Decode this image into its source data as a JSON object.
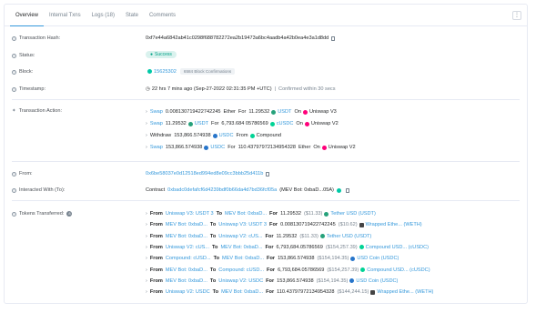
{
  "tabs": [
    "Overview",
    "Internal Txns",
    "Logs (18)",
    "State",
    "Comments"
  ],
  "labels": {
    "tx_hash": "Transaction Hash:",
    "status": "Status:",
    "block": "Block:",
    "timestamp": "Timestamp:",
    "action": "Transaction Action:",
    "from": "From:",
    "interacted": "Interacted With (To):",
    "tokens": "Tokens Transferred:"
  },
  "tx_hash": "0xf7e44a6842ab41c0298f688782272ea2b19473a6bc4aadb4a42b0ea4e3a1d8dd",
  "status": "Success",
  "block": {
    "number": "15625302",
    "confirmations": "6584 Block Confirmations"
  },
  "timestamp": {
    "text": "22 hrs 7 mins ago (Sep-27-2022 02:31:35 PM +UTC)",
    "sep": "|",
    "confirmed": "Confirmed within 30 secs"
  },
  "actions": [
    {
      "verb": "Swap",
      "amt1": "0.008130719422742245",
      "tok1": "Ether",
      "mid": "For",
      "amt2": "11.29532",
      "tok2": "USDT",
      "on": "On",
      "dex": "Uniswap V3",
      "i1": "",
      "i2": "tether",
      "i3": "uni"
    },
    {
      "verb": "Swap",
      "amt1": "11.29532",
      "tok1": "USDT",
      "mid": "For",
      "amt2": "6,793.684 05786569",
      "tok2": "cUSDC",
      "on": "On",
      "dex": "Uniswap V2",
      "i1": "tether",
      "i2": "comp",
      "i3": "uni"
    },
    {
      "verb": "Withdraw",
      "amt1": "153,866.574938",
      "tok1": "USDC",
      "mid": "From",
      "amt2": "",
      "tok2": "Compound",
      "on": "",
      "dex": "",
      "i1": "usdc",
      "i2": "comp",
      "i3": ""
    },
    {
      "verb": "Swap",
      "amt1": "153,866.574938",
      "tok1": "USDC",
      "mid": "For",
      "amt2": "110.43797972134954328",
      "tok2": "Ether",
      "on": "On",
      "dex": "Uniswap V2",
      "i1": "usdc",
      "i2": "",
      "i3": "uni"
    }
  ],
  "from": "0x6be58037e0d12518ed994ed8e09cc3bbb25d411b",
  "interacted": {
    "prefix": "Contract",
    "address": "0xbadc0defafcf6d4239bdf0b66da4d7bd36fcf05a",
    "name": "(MEV Bot: 0xbaD...05A)"
  },
  "token_count": "8",
  "transfers": [
    {
      "from_lbl": "From",
      "from": "Uniswap V3: USDT 3",
      "to_lbl": "To",
      "to": "MEV Bot: 0xbaD...",
      "for_lbl": "For",
      "amount": "11.29532",
      "usd": "($11.33)",
      "token": "Tether USD (USDT)",
      "icon": "tether"
    },
    {
      "from_lbl": "From",
      "from": "MEV Bot: 0xbaD...",
      "to_lbl": "To",
      "to": "Uniswap V3: USDT 3",
      "for_lbl": "For",
      "amount": "0.008130719422742245",
      "usd": "($10.62)",
      "token": "Wrapped Ethe... (WETH)",
      "icon": "weth"
    },
    {
      "from_lbl": "From",
      "from": "MEV Bot: 0xbaD...",
      "to_lbl": "To",
      "to": "Uniswap V2: cUS...",
      "for_lbl": "For",
      "amount": "11.29532",
      "usd": "($11.33)",
      "token": "Tether USD (USDT)",
      "icon": "tether"
    },
    {
      "from_lbl": "From",
      "from": "Uniswap V2: cUS...",
      "to_lbl": "To",
      "to": "MEV Bot: 0xbaD...",
      "for_lbl": "For",
      "amount": "6,793,684.05786569",
      "usd": "($154,257.39)",
      "token": "Compound USD... (cUSDC)",
      "icon": "comp"
    },
    {
      "from_lbl": "From",
      "from": "Compound: cUSD...",
      "to_lbl": "To",
      "to": "MEV Bot: 0xbaD...",
      "for_lbl": "For",
      "amount": "153,866.574938",
      "usd": "($154,194.35)",
      "token": "USD Coin (USDC)",
      "icon": "usdc"
    },
    {
      "from_lbl": "From",
      "from": "MEV Bot: 0xbaD...",
      "to_lbl": "To",
      "to": "Compound: cUSD...",
      "for_lbl": "For",
      "amount": "6,793,684.05786569",
      "usd": "($154,257.39)",
      "token": "Compound USD... (cUSDC)",
      "icon": "comp"
    },
    {
      "from_lbl": "From",
      "from": "MEV Bot: 0xbaD...",
      "to_lbl": "To",
      "to": "Uniswap V2: USDC",
      "for_lbl": "For",
      "amount": "153,866.574938",
      "usd": "($154,194.35)",
      "token": "USD Coin (USDC)",
      "icon": "usdc"
    },
    {
      "from_lbl": "From",
      "from": "Uniswap V2: USDC",
      "to_lbl": "To",
      "to": "MEV Bot: 0xbaD...",
      "for_lbl": "For",
      "amount": "110.43797972134954328",
      "usd": "($144,244.15)",
      "token": "Wrapped Ethe... (WETH)",
      "icon": "weth"
    }
  ],
  "more_icon": "more-icon",
  "colors": {
    "link": "#3498db",
    "success": "#00a186",
    "tab_active": "#3498db"
  }
}
